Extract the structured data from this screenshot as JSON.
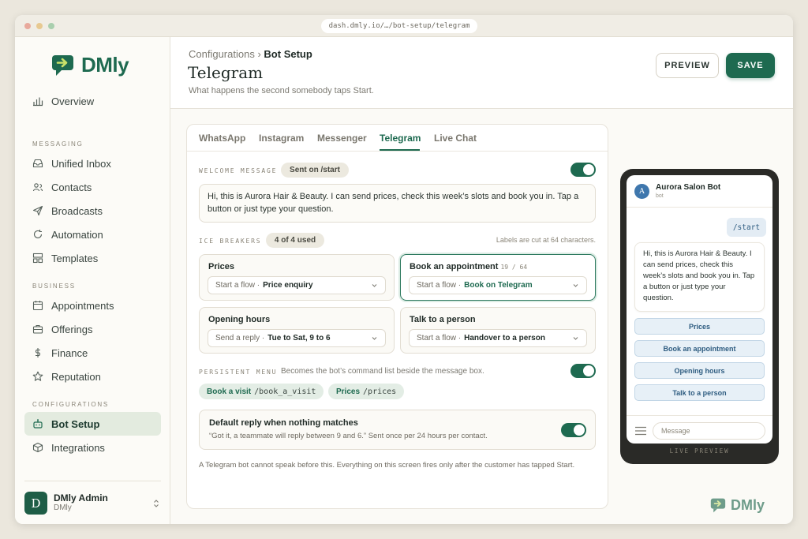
{
  "window": {
    "url": "dash.dmly.io/…/bot-setup/telegram",
    "dots": [
      "#e8a99c",
      "#e7c991",
      "#a9cfae"
    ]
  },
  "brand": {
    "name": "DMly",
    "color": "#1e6a50"
  },
  "sidebar": {
    "overview": "Overview",
    "sections": [
      {
        "label": "MESSAGING",
        "items": [
          "Unified Inbox",
          "Contacts",
          "Broadcasts",
          "Automation",
          "Templates"
        ]
      },
      {
        "label": "BUSINESS",
        "items": [
          "Appointments",
          "Offerings",
          "Finance",
          "Reputation"
        ]
      },
      {
        "label": "CONFIGURATIONS",
        "items": [
          "Bot Setup",
          "Integrations"
        ]
      }
    ],
    "active_item": "Bot Setup",
    "user": {
      "initial": "D",
      "name": "DMly Admin",
      "org": "DMly"
    }
  },
  "header": {
    "breadcrumb_parent": "Configurations",
    "breadcrumb_sep": "›",
    "breadcrumb_current": "Bot Setup",
    "title": "Telegram",
    "subtitle": "What happens the second somebody taps Start.",
    "preview_label": "PREVIEW",
    "save_label": "SAVE"
  },
  "tabs": [
    "WhatsApp",
    "Instagram",
    "Messenger",
    "Telegram",
    "Live Chat"
  ],
  "active_tab": "Telegram",
  "welcome": {
    "label": "WELCOME MESSAGE",
    "chip": "Sent on /start",
    "enabled": true,
    "text": "Hi, this is Aurora Hair & Beauty. I can send prices, check this week’s slots and book you in. Tap a button or just type your question."
  },
  "ice_breakers": {
    "label": "ICE BREAKERS",
    "count_chip": "4 of 4 used",
    "hint": "Labels are cut at 64 characters.",
    "cards": [
      {
        "title": "Prices",
        "counter": "",
        "action": "Start a flow ·",
        "target": "Price enquiry",
        "selected": false
      },
      {
        "title": "Book an appointment",
        "counter": "19 / 64",
        "action": "Start a flow ·",
        "target": "Book on Telegram",
        "selected": true
      },
      {
        "title": "Opening hours",
        "counter": "",
        "action": "Send a reply ·",
        "target": "Tue to Sat, 9 to 6",
        "selected": false
      },
      {
        "title": "Talk to a person",
        "counter": "",
        "action": "Start a flow ·",
        "target": "Handover to a person",
        "selected": false
      }
    ]
  },
  "persistent_menu": {
    "label": "PERSISTENT MENU",
    "desc": "Becomes the bot’s command list beside the message box.",
    "enabled": true,
    "items": [
      {
        "label": "Book a visit",
        "command": "/book_a_visit"
      },
      {
        "label": "Prices",
        "command": "/prices"
      }
    ]
  },
  "default_reply": {
    "title": "Default reply when nothing matches",
    "desc": "“Got it, a teammate will reply between 9 and 6.” Sent once per 24 hours per contact.",
    "enabled": true
  },
  "footer_note": "A Telegram bot cannot speak before this. Everything on this screen fires only after the customer has tapped Start.",
  "phone": {
    "bot_initial": "A",
    "bot_name": "Aurora Salon Bot",
    "bot_sub": "bot",
    "user_msg": "/start",
    "bot_msg": "Hi, this is Aurora Hair & Beauty. I can send prices, check this week’s slots and book you in. Tap a button or just type your question.",
    "buttons": [
      "Prices",
      "Book an appointment",
      "Opening hours",
      "Talk to a person"
    ],
    "input_placeholder": "Message",
    "caption": "LIVE PREVIEW"
  }
}
